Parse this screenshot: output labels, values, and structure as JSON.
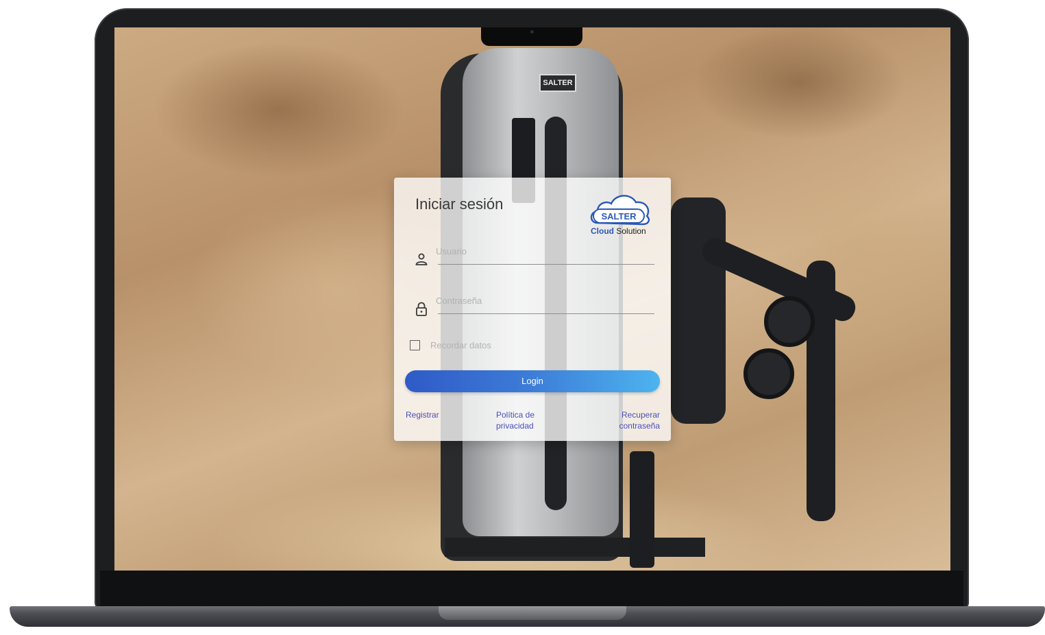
{
  "login": {
    "title": "Iniciar sesión",
    "username_placeholder": "Usuario",
    "password_placeholder": "Contraseña",
    "remember_label": "Recordar datos",
    "login_button": "Login",
    "links": {
      "register": "Registrar",
      "privacy_line1": "Política de",
      "privacy_line2": "privacidad",
      "recover_line1": "Recuperar",
      "recover_line2": "contraseña"
    }
  },
  "logo": {
    "wordmark": "SALTER",
    "sub_bold": "Cloud",
    "sub_rest": "Solution"
  },
  "machine_badge": "SALTER",
  "colors": {
    "brand_blue": "#2a58b8",
    "button_gradient_start": "#2f5ac7",
    "button_gradient_end": "#4db4ef",
    "link": "#4a4fb8"
  },
  "icons": {
    "username": "user-icon",
    "password": "lock-icon",
    "logo": "cloud-icon"
  }
}
